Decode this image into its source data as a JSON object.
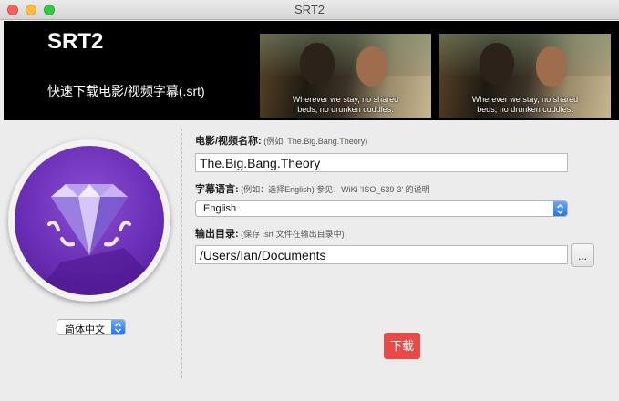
{
  "window": {
    "title": "SRT2"
  },
  "banner": {
    "app_name": "SRT2",
    "subtitle": "快速下载电影/视频字幕(.srt)",
    "preview_caption_line1": "Wherever we stay, no shared",
    "preview_caption_line2": "beds, no drunken cuddles."
  },
  "sidebar": {
    "language_select": {
      "value": "简体中文"
    }
  },
  "form": {
    "title_label": "电影/视频名称:",
    "title_hint": " (例如. The.Big.Bang.Theory)",
    "title_value": "The.Big.Bang.Theory",
    "sub_lang_label": "字幕语言:",
    "sub_lang_hint": " (例如：选择English) 参见：WiKi 'ISO_639-3' 的说明",
    "sub_lang_value": "English",
    "output_label": "输出目录:",
    "output_hint": " (保存 .srt 文件在输出目录中)",
    "output_value": "/Users/Ian/Documents",
    "browse_label": "...",
    "download_label": "下载"
  },
  "colors": {
    "accent": "#1f74f2",
    "download": "#e84a47",
    "icon": "#6a2fb6"
  }
}
